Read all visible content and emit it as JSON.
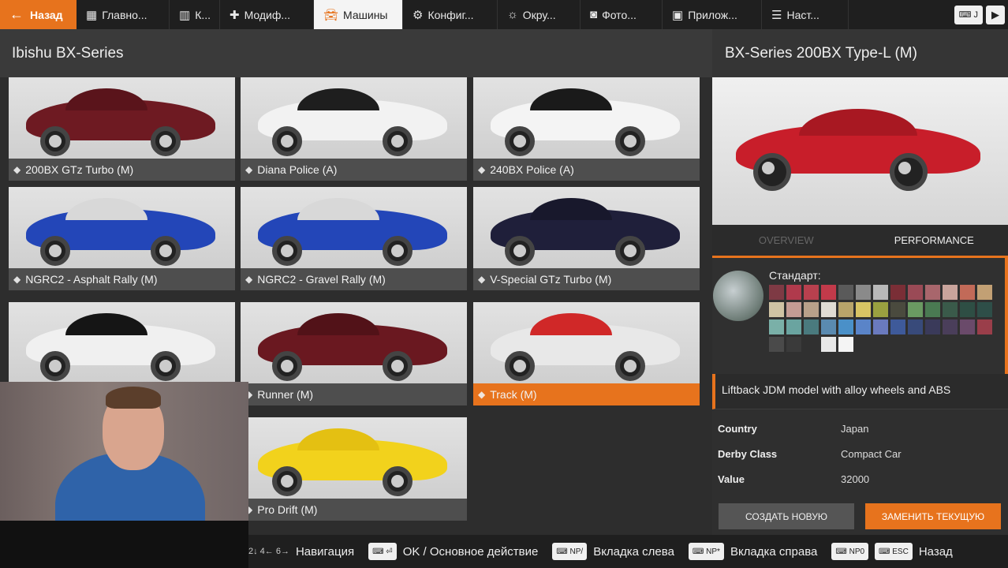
{
  "topbar": {
    "back_label": "Назад",
    "tabs": [
      {
        "label": "Главно...",
        "icon": "grid-icon"
      },
      {
        "label": "К...",
        "icon": "map-icon"
      },
      {
        "label": "Модиф...",
        "icon": "puzzle-icon"
      },
      {
        "label": "Машины",
        "icon": "car-icon",
        "active": true
      },
      {
        "label": "Конфиг...",
        "icon": "engine-icon"
      },
      {
        "label": "Окру...",
        "icon": "weather-icon"
      },
      {
        "label": "Фото...",
        "icon": "camera-icon"
      },
      {
        "label": "Прилож...",
        "icon": "apps-icon"
      },
      {
        "label": "Наст...",
        "icon": "sliders-icon"
      }
    ],
    "kbd_label": "J"
  },
  "left": {
    "title": "Ibishu BX-Series",
    "cards": [
      {
        "label": "200BX GTz Turbo (M)",
        "color": "#6e1a22",
        "roof": "#5a141b"
      },
      {
        "label": "Diana Police (A)",
        "color": "#f2f2f2",
        "roof": "#1e1e1e"
      },
      {
        "label": "240BX Police (A)",
        "color": "#f4f4f4",
        "roof": "#1a1a1a"
      },
      {
        "label": "NGRC2 - Asphalt Rally (M)",
        "color": "#2346b8",
        "roof": "#d8d8d8"
      },
      {
        "label": "NGRC2 - Gravel Rally (M)",
        "color": "#2346b8",
        "roof": "#d8d8d8"
      },
      {
        "label": "V-Special GTz Turbo (M)",
        "color": "#1f1f3a",
        "roof": "#18182c"
      },
      {
        "label": "",
        "color": "#f0f0f0",
        "roof": "#151515"
      },
      {
        "label": "Runner (M)",
        "color": "#6a1820",
        "roof": "#521218"
      },
      {
        "label": "Track (M)",
        "color": "#e8e8e8",
        "roof": "#d02828",
        "selected": true
      },
      {
        "label": "",
        "color": "#cccccc",
        "roof": "#bbbbbb"
      },
      {
        "label": "Pro Drift (M)",
        "color": "#f2d21c",
        "roof": "#e4c012"
      }
    ]
  },
  "right": {
    "title": "BX-Series 200BX Type-L (M)",
    "preview_color": "#c81e2a",
    "tabs": [
      "OVERVIEW",
      "PERFORMANCE"
    ],
    "active_tab": "PERFORMANCE",
    "config_label": "Стандарт:",
    "swatches": [
      "#7e3a44",
      "#b03a4c",
      "#b8404e",
      "#c23a4a",
      "#5a5a5a",
      "#8a8a8a",
      "#b8b8b8",
      "#7a2e36",
      "#9a4a56",
      "#a8666c",
      "#c9a49c",
      "#c26a58",
      "#c2a074",
      "#cfc3a4",
      "#c49c94",
      "#b8a08a",
      "#e0dcd4",
      "#b8a46a",
      "#d8c464",
      "#9aa040",
      "#4a4a3e",
      "#6a9a62",
      "#4a7a52",
      "#3a5a4a",
      "#2e4e44",
      "#2e4e48",
      "#7ab0a8",
      "#6aa4a0",
      "#4a7a7e",
      "#5a8ab0",
      "#4a90c8",
      "#5a84c8",
      "#6a7abe",
      "#3e5a9a",
      "#384a7a",
      "#3a3a5a",
      "#4a3e5a",
      "#6a4a6a",
      "#9a3e4a",
      "#4a4a4a",
      "#3a3a3a",
      "#303030",
      "#e8e8e8",
      "#f4f4f4"
    ],
    "description": "Liftback JDM model with alloy wheels and ABS",
    "specs": [
      {
        "key": "Country",
        "value": "Japan"
      },
      {
        "key": "Derby Class",
        "value": "Compact Car"
      },
      {
        "key": "Value",
        "value": "32000"
      }
    ],
    "create_label": "СОЗДАТЬ НОВУЮ",
    "replace_label": "ЗАМЕНИТЬ ТЕКУЩУЮ"
  },
  "hints": [
    {
      "key": "2↓ 4← 6→",
      "label": "Навигация"
    },
    {
      "key": "⏎",
      "label": "OK / Основное действие"
    },
    {
      "key": "NP/",
      "label": "Вкладка слева"
    },
    {
      "key": "NP*",
      "label": "Вкладка справа"
    },
    {
      "key": "NP0",
      "label": ""
    },
    {
      "key": "ESC",
      "label": "Назад"
    }
  ]
}
